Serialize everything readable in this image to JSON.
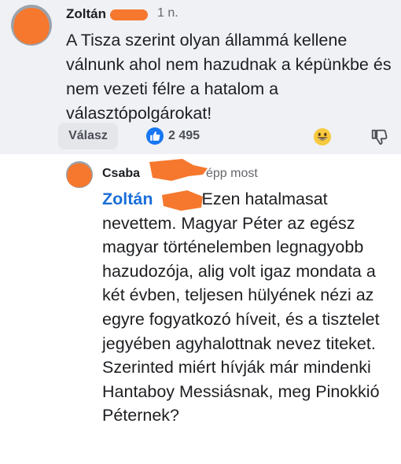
{
  "comment": {
    "author": "Zoltán",
    "time": "1 n.",
    "text": "A Tisza szerint olyan állammá kellene válnunk ahol nem hazudnak a képünkbe és nem vezeti félre a hatalom a választópolgárokat!",
    "reply_label": "Válasz",
    "like_count": "2 495",
    "icons": {
      "like": "thumbs-up-icon",
      "reaction": "grinning-face-icon",
      "dislike": "thumbs-down-icon"
    }
  },
  "reply": {
    "author": "Csaba",
    "time": "épp most",
    "mention": "Zoltán",
    "text": "Ezen hatalmasat nevettem. Magyar Péter az egész magyar történelemben legnagyobb hazudozója, alig volt igaz mondata a két évben, teljesen hülyének nézi az egyre fogyatkozó híveit, és a tisztelet jegyében agyhalottnak nevez titeket. Szerinted miért hívják már mindenki Hantaboy Messiásnak, meg Pinokkió Péternek?"
  },
  "colors": {
    "accent": "#1877f2",
    "mention": "#1a6ed8",
    "redaction": "#f5782e",
    "band": "#f0f1f4"
  }
}
